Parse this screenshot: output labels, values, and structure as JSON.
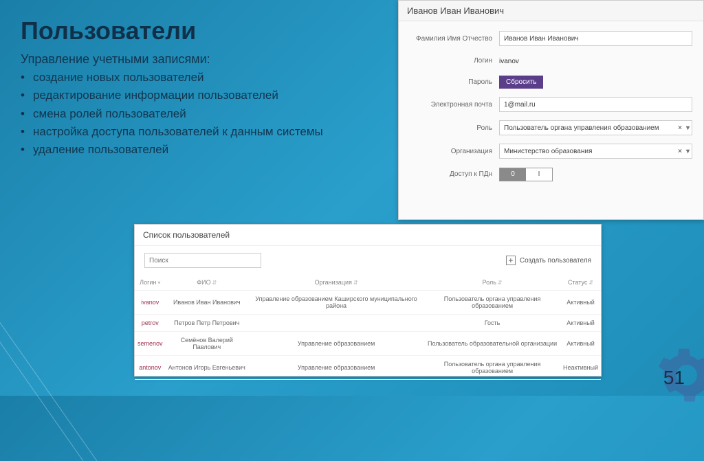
{
  "slide": {
    "title": "Пользователи",
    "subtitle": "Управление учетными записями:",
    "bullets": [
      "создание новых пользователей",
      "редактирование информации пользователей",
      "смена ролей пользователей",
      "настройка доступа пользователей к данным системы",
      "удаление пользователей"
    ],
    "page": "51"
  },
  "edit": {
    "header": "Иванов Иван Иванович",
    "labels": {
      "fio": "Фамилия Имя Отчество",
      "login": "Логин",
      "password": "Пароль",
      "email": "Электронная почта",
      "role": "Роль",
      "org": "Организация",
      "access": "Доступ к ПДн"
    },
    "values": {
      "fio": "Иванов Иван Иванович",
      "login": "ivanov",
      "email": "1@mail.ru",
      "role": "Пользователь органа управления образованием",
      "org": "Министерство образования"
    },
    "reset_btn": "Сбросить",
    "toggle": {
      "on": "0",
      "off": "I"
    }
  },
  "list": {
    "header": "Список пользователей",
    "search_placeholder": "Поиск",
    "create_label": "Создать пользователя",
    "columns": [
      "Логин",
      "ФИО",
      "Организация",
      "Роль",
      "Статус"
    ],
    "rows": [
      {
        "login": "ivanov",
        "fio": "Иванов Иван Иванович",
        "org": "Управление образованием Каширского муниципального района",
        "role": "Пользователь органа управления образованием",
        "status": "Активный"
      },
      {
        "login": "petrov",
        "fio": "Петров Петр Петрович",
        "org": "",
        "role": "Гость",
        "status": "Активный"
      },
      {
        "login": "semenov",
        "fio": "Семёнов Валерий Павлович",
        "org": "Управление образованием",
        "role": "Пользователь образовательной организации",
        "status": "Активный"
      },
      {
        "login": "antonov",
        "fio": "Антонов Игорь Евгеньевич",
        "org": "Управление образованием",
        "role": "Пользователь органа управления образованием",
        "status": "Неактивный"
      }
    ]
  }
}
